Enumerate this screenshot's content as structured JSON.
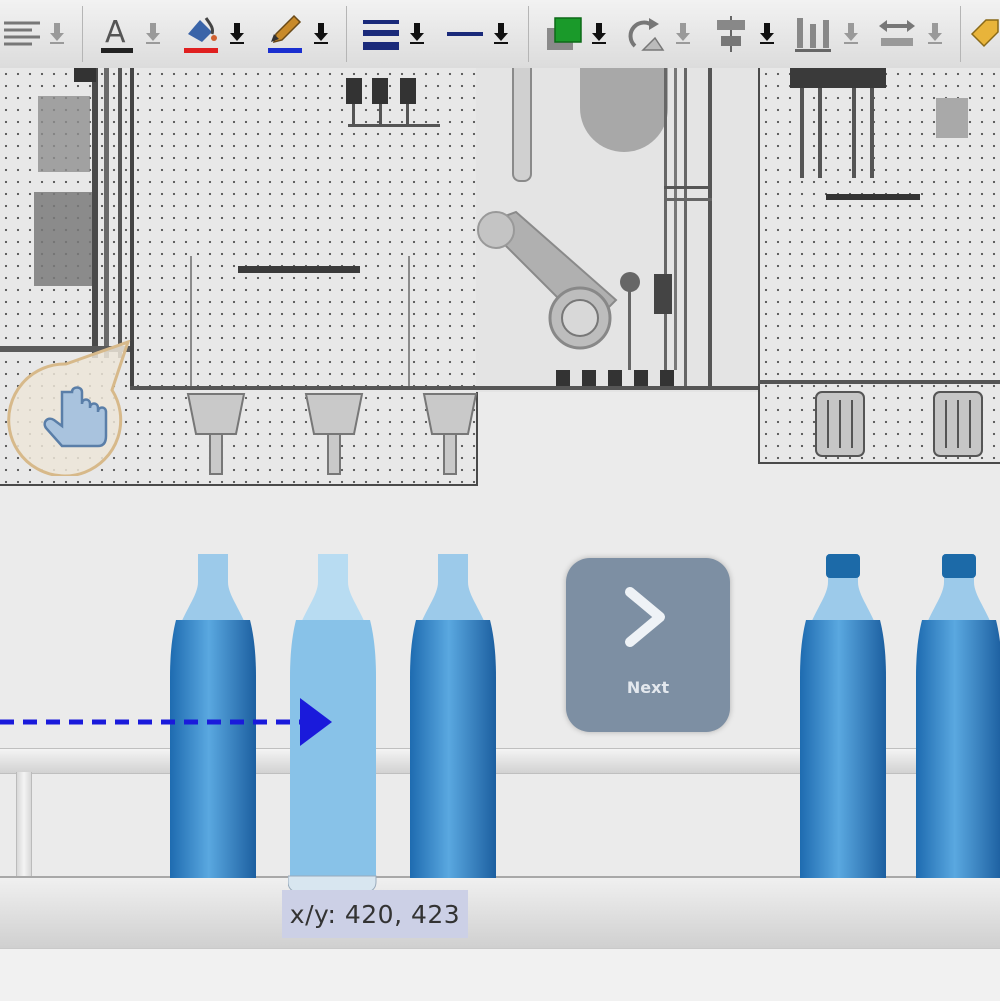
{
  "toolbar": {
    "items": [
      {
        "name": "text-align-icon"
      },
      {
        "name": "font-color-icon",
        "color": "#222222"
      },
      {
        "name": "fill-color-icon",
        "color": "#e02020"
      },
      {
        "name": "line-color-icon",
        "color": "#1a2fd0"
      },
      {
        "name": "line-width-icon"
      },
      {
        "name": "line-style-icon"
      },
      {
        "name": "shadow-icon",
        "color": "#1a9a2a"
      },
      {
        "name": "rotate-icon"
      },
      {
        "name": "align-icon"
      },
      {
        "name": "distribute-icon"
      },
      {
        "name": "spacing-icon"
      },
      {
        "name": "tag-icon"
      }
    ]
  },
  "canvas": {
    "next_button": {
      "label": "Next"
    },
    "coordinates": "x/y: 420, 423",
    "colors": {
      "bottle_water": "#2f86c8",
      "bottle_cap": "#1c6aa8",
      "arrow": "#1a1adb",
      "button_bg": "#7d8fa3"
    }
  }
}
